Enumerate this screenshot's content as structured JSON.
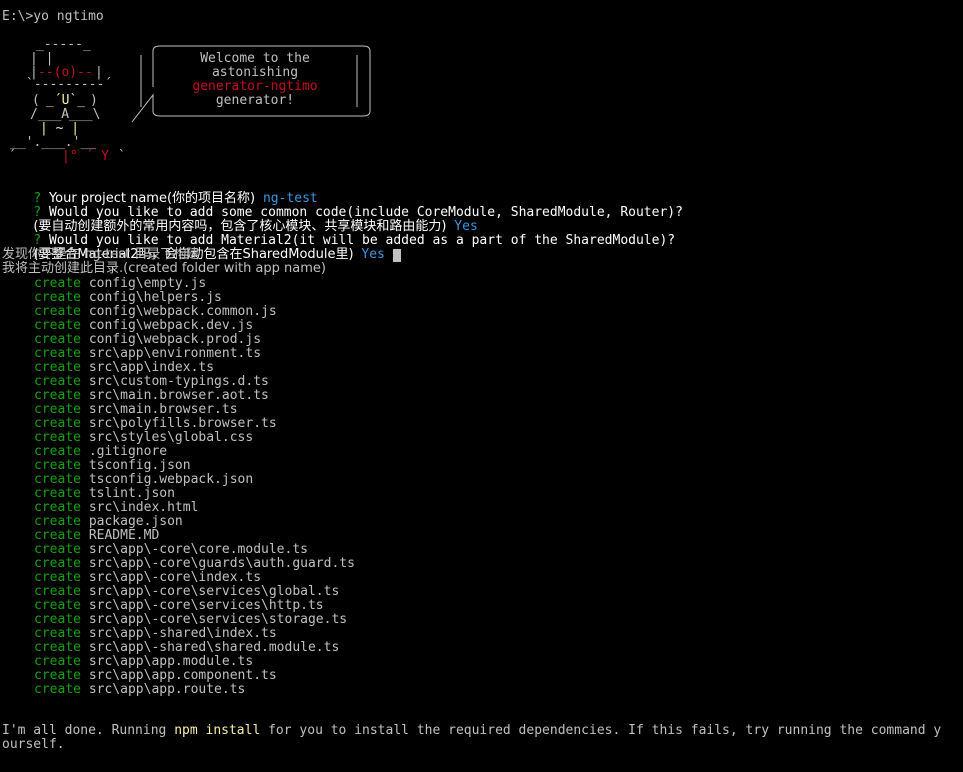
{
  "terminal": {
    "prompt": "E:\\>yo ngtimo",
    "welcome": {
      "line1": "Welcome to the",
      "line2": "astonishing",
      "line3": "generator-ngtimo",
      "line4": "generator!"
    },
    "questions": [
      {
        "mark": "?",
        "text": "Your project name(你的项目名称)",
        "answer": "ng-test"
      },
      {
        "mark": "?",
        "text": "Would you like to add some common code(include CoreModule, SharedModule, Router)?",
        "answer": ""
      },
      {
        "mark": "",
        "text": "(要自动创建额外的常用内容吗，包含了核心模块、共享模块和路由能力)",
        "answer": "Yes"
      },
      {
        "mark": "?",
        "text": "Would you like to add Material2(it will be added as a part of the SharedModule)?",
        "answer": ""
      },
      {
        "mark": "",
        "text": "(要整合Material2吗，会自动包含在SharedModule里)",
        "answer": "Yes"
      }
    ],
    "notice1": "发现你不是在 ng-test 目录下构建",
    "notice2": "我将主动创建此目录.(created folder with app name)",
    "create_verb": "create",
    "files": [
      "config\\empty.js",
      "config\\helpers.js",
      "config\\webpack.common.js",
      "config\\webpack.dev.js",
      "config\\webpack.prod.js",
      "src\\app\\environment.ts",
      "src\\app\\index.ts",
      "src\\custom-typings.d.ts",
      "src\\main.browser.aot.ts",
      "src\\main.browser.ts",
      "src\\polyfills.browser.ts",
      "src\\styles\\global.css",
      ".gitignore",
      "tsconfig.json",
      "tsconfig.webpack.json",
      "tslint.json",
      "src\\index.html",
      "package.json",
      "README.MD",
      "src\\app\\-core\\core.module.ts",
      "src\\app\\-core\\guards\\auth.guard.ts",
      "src\\app\\-core\\index.ts",
      "src\\app\\-core\\services\\global.ts",
      "src\\app\\-core\\services\\http.ts",
      "src\\app\\-core\\services\\storage.ts",
      "src\\app\\-shared\\index.ts",
      "src\\app\\-shared\\shared.module.ts",
      "src\\app\\app.module.ts",
      "src\\app\\app.component.ts",
      "src\\app\\app.route.ts"
    ],
    "done": {
      "part1": "I'm all done. Running ",
      "cmd": "npm install",
      "part2": " for you to install the required dependencies. If this fails, try running the command y",
      "part3": "ourself."
    },
    "colors": {
      "background": "#000000",
      "text": "#c0c0c0",
      "green": "#13a10e",
      "cyan": "#3a96dd",
      "yellow": "#f9f1a5",
      "red": "#c50f1f"
    }
  }
}
